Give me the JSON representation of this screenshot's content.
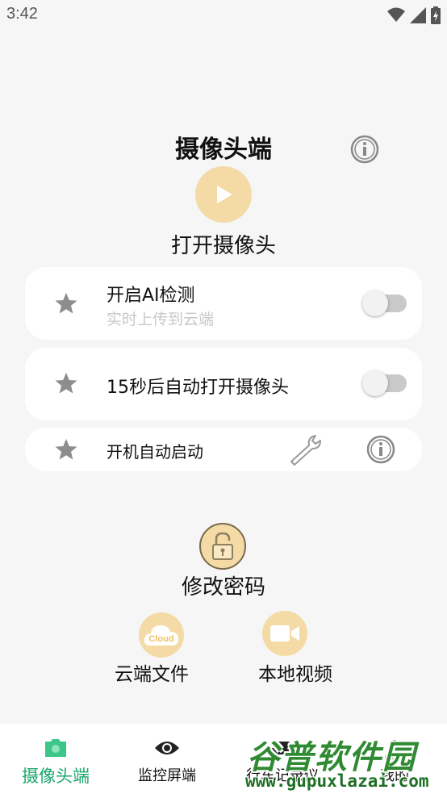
{
  "status_bar": {
    "time": "3:42",
    "icons": [
      "wifi-icon",
      "signal-icon",
      "battery-charging-icon"
    ]
  },
  "header": {
    "title": "摄像头端",
    "info_icon": "info-icon"
  },
  "open_camera": {
    "label": "打开摄像头",
    "icon": "play-icon"
  },
  "settings": {
    "ai_detect": {
      "title": "开启AI检测",
      "subtitle": "实时上传到云端",
      "enabled": false
    },
    "auto_open": {
      "title": "15秒后自动打开摄像头",
      "enabled": false
    },
    "boot_start": {
      "title": "开机自动启动"
    }
  },
  "password": {
    "label": "修改密码",
    "icon": "unlock-icon"
  },
  "files": {
    "cloud": {
      "label": "云端文件",
      "icon_text": "Cloud"
    },
    "local": {
      "label": "本地视频",
      "icon": "video-camera-icon"
    }
  },
  "tabbar": {
    "tabs": [
      {
        "label": "摄像头端",
        "icon": "camera-icon",
        "active": true
      },
      {
        "label": "监控屏端",
        "icon": "eye-icon",
        "active": false
      },
      {
        "label": "行车记录仪",
        "icon": "car-icon",
        "active": false
      },
      {
        "label": "我的",
        "icon": "user-icon",
        "active": false
      }
    ]
  },
  "watermark": {
    "brand": "谷普软件园",
    "url": "www.gupuxlazai.com"
  },
  "colors": {
    "accent_yellow": "#f4dba5",
    "active_tab": "#1aa76b",
    "subtitle_gray": "#c8c8c8",
    "watermark_green": "#2f8a32"
  }
}
